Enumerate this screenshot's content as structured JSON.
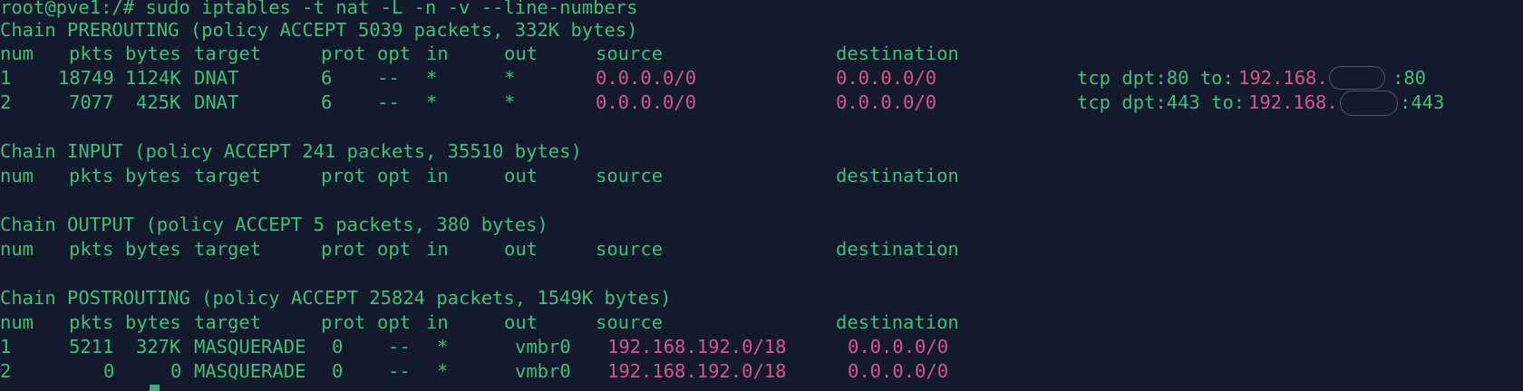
{
  "terminal": {
    "prompt_command": "root@pve1:/# sudo iptables -t nat -L -n -v --line-numbers",
    "colors": {
      "background": "#131a2b",
      "text": "#3fbf7a",
      "address": "#d7558e",
      "cursor": "#2fb77a"
    },
    "headers": [
      "num",
      "pkts",
      "bytes",
      "target",
      "prot",
      "opt",
      "in",
      "out",
      "source",
      "destination"
    ],
    "prerouting": {
      "title": "Chain PREROUTING (policy ACCEPT 5039 packets, 332K bytes)",
      "rows": [
        {
          "num": "1",
          "pkts": "18749",
          "bytes": "1124K",
          "target": "DNAT",
          "prot": "6",
          "opt": "--",
          "in": "*",
          "out": "*",
          "source": "0.0.0.0/0",
          "destination": "0.0.0.0/0",
          "extra_prefix": "tcp dpt:80 to:",
          "extra_ip": "192.168.",
          "extra_suffix": ":80"
        },
        {
          "num": "2",
          "pkts": "7077",
          "bytes": "425K",
          "target": "DNAT",
          "prot": "6",
          "opt": "--",
          "in": "*",
          "out": "*",
          "source": "0.0.0.0/0",
          "destination": "0.0.0.0/0",
          "extra_prefix": "tcp dpt:443 to:",
          "extra_ip": "192.168.",
          "extra_suffix": ":443"
        }
      ]
    },
    "input": {
      "title": "Chain INPUT (policy ACCEPT 241 packets, 35510 bytes)"
    },
    "output": {
      "title": "Chain OUTPUT (policy ACCEPT 5 packets, 380 bytes)"
    },
    "postrouting": {
      "title": "Chain POSTROUTING (policy ACCEPT 25824 packets, 1549K bytes)",
      "rows": [
        {
          "num": "1",
          "pkts": "5211",
          "bytes": "327K",
          "target": "MASQUERADE",
          "prot": "0",
          "opt": "--",
          "in": "*",
          "out": "vmbr0",
          "source": "192.168.192.0/18",
          "destination": "0.0.0.0/0"
        },
        {
          "num": "2",
          "pkts": "0",
          "bytes": "0",
          "target": "MASQUERADE",
          "prot": "0",
          "opt": "--",
          "in": "*",
          "out": "vmbr0",
          "source": "192.168.192.0/18",
          "destination": "0.0.0.0/0"
        }
      ]
    }
  }
}
